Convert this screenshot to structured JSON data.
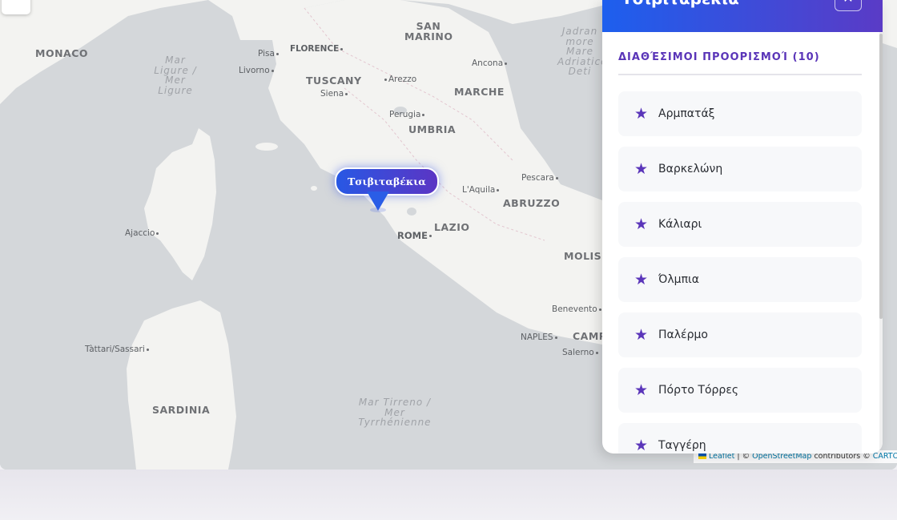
{
  "map": {
    "regions": [
      {
        "key": "monaco",
        "label": "MONACO"
      },
      {
        "key": "tuscany",
        "label": "TUSCANY"
      },
      {
        "key": "umbria",
        "label": "UMBRIA"
      },
      {
        "key": "marche",
        "label": "MARCHE"
      },
      {
        "key": "lazio",
        "label": "LAZIO"
      },
      {
        "key": "abruzzo",
        "label": "ABRUZZO"
      },
      {
        "key": "molise",
        "label": "MOLISE"
      },
      {
        "key": "sardinia",
        "label": "SARDINIA"
      },
      {
        "key": "campania",
        "label": "CAMP"
      },
      {
        "key": "san_marino",
        "label": "SAN MARINO"
      }
    ],
    "cities": [
      {
        "key": "pisa",
        "label": "Pisa"
      },
      {
        "key": "florence",
        "label": "FLORENCE"
      },
      {
        "key": "livorno",
        "label": "Livorno"
      },
      {
        "key": "arezzo",
        "label": "Arezzo"
      },
      {
        "key": "siena",
        "label": "Siena"
      },
      {
        "key": "perugia",
        "label": "Perugia"
      },
      {
        "key": "ancona",
        "label": "Ancona"
      },
      {
        "key": "pescara",
        "label": "Pescara"
      },
      {
        "key": "laquila",
        "label": "L'Aquila"
      },
      {
        "key": "rome",
        "label": "ROME"
      },
      {
        "key": "ajaccio",
        "label": "Ajaccio"
      },
      {
        "key": "benevento",
        "label": "Benevento"
      },
      {
        "key": "naples",
        "label": "NAPLES"
      },
      {
        "key": "salerno",
        "label": "Salerno"
      },
      {
        "key": "tattari",
        "label": "Tàttari/Sassari"
      }
    ],
    "seas": [
      {
        "key": "ligure",
        "label": "Mar Ligure / Mer Ligure"
      },
      {
        "key": "tirreno",
        "label": "Mar Tirreno / Mer Tyrrhénienne"
      },
      {
        "key": "adriatico",
        "label": "Jadran more Mare Adriatico Deti"
      }
    ],
    "marker_label": "Τσιβιταβέκια",
    "attribution": {
      "leaflet": "Leaflet",
      "sep": " | © ",
      "osm": "OpenStreetMap",
      "contrib": " contributors © ",
      "carto": "CARTO"
    }
  },
  "panel": {
    "title": "Τσιβιταβέκια",
    "close_icon": "✕",
    "heading": "ΔΙΑΘΈΣΙΜΟΙ ΠΡΟΟΡΙΣΜΟΊ (10)",
    "destinations": [
      {
        "label": "Αρμπατάξ"
      },
      {
        "label": "Βαρκελώνη"
      },
      {
        "label": "Κάλιαρι"
      },
      {
        "label": "Όλμπια"
      },
      {
        "label": "Παλέρμο"
      },
      {
        "label": "Πόρτο Τόρρες"
      },
      {
        "label": "Ταγγέρη"
      }
    ],
    "star_icon": "★"
  },
  "colors": {
    "accent_blue": "#1d5fee",
    "accent_purple": "#5a3bc6",
    "sea": "#d4d7da",
    "land": "#f3f3f1"
  }
}
